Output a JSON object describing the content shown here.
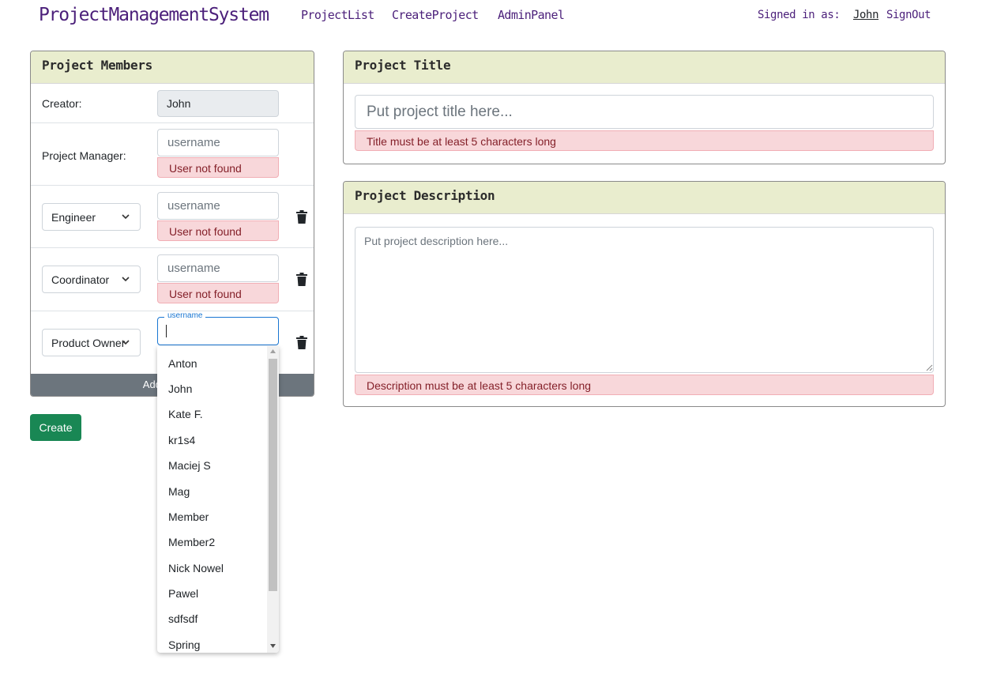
{
  "nav": {
    "brand": "ProjectManagementSystem",
    "links": [
      "ProjectList",
      "CreateProject",
      "AdminPanel"
    ],
    "signed_in_prefix": "Signed in as:",
    "signed_in_user": "John",
    "signout": "SignOut"
  },
  "members": {
    "header": "Project Members",
    "creator_label": "Creator:",
    "creator_value": "John",
    "manager_label": "Project Manager:",
    "username_placeholder": "username",
    "error_text": "User not found",
    "roles": [
      "Engineer",
      "Coordinator",
      "Product Owner"
    ],
    "focused_label": "username",
    "add_button": "Add member"
  },
  "suggestions": [
    "Anton",
    "John",
    "Kate F.",
    "kr1s4",
    "Maciej S",
    "Mag",
    "Member",
    "Member2",
    "Nick Nowel",
    "Pawel",
    "sdfsdf",
    "Spring"
  ],
  "create_button": "Create",
  "title_card": {
    "header": "Project Title",
    "placeholder": "Put project title here...",
    "error": "Title must be at least 5 characters long"
  },
  "description_card": {
    "header": "Project Description",
    "placeholder": "Put project description here...",
    "error": "Description must be at least 5 characters long"
  }
}
